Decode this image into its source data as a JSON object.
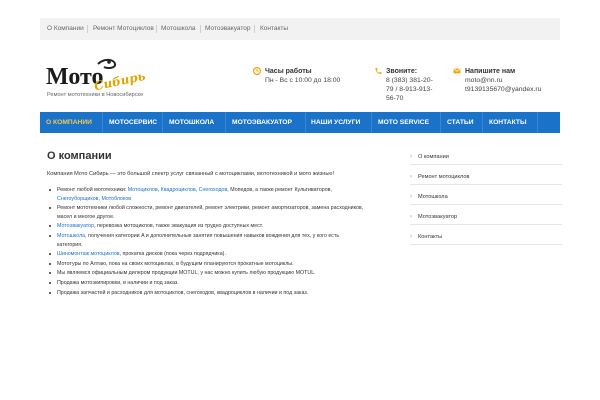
{
  "topbar": {
    "links": [
      "О Компании",
      "Ремонт Мотоциклов",
      "Мотошкола",
      "Мотоэвакуатор",
      "Контакты"
    ]
  },
  "header": {
    "logo_text": "Мото Сибирь",
    "tagline": "Ремонт мототехники в Новосибирске",
    "hours": {
      "title": "Часы работы",
      "value": "Пн - Вс с 10:00 до 18:00"
    },
    "phone": {
      "title": "Звоните:",
      "lines": [
        "8 (383) 381-20-",
        "79 / 8-913-913-",
        "56-70"
      ]
    },
    "email": {
      "title": "Напишите нам",
      "lines": [
        "moto@nn.ru",
        "t9139135670@yandex.ru"
      ]
    }
  },
  "nav": {
    "items": [
      "О КОМПАНИИ",
      "МОТОСЕРВИС",
      "МОТОШКОЛА",
      "МОТОЭВАКУАТОР",
      "НАШИ УСЛУГИ",
      "MOTO SERVICE",
      "СТАТЬИ",
      "КОНТАКТЫ"
    ],
    "active_index": 0
  },
  "main": {
    "title": "О компании",
    "intro": "Компания Мото Сибирь — это большой спектр услуг связанный с мотоциклами, мототехникой и мото жизнью!",
    "bullets": [
      {
        "lines": [
          [
            {
              "t": "Ремонт любой мототехники: "
            },
            {
              "t": "Мотоциклов",
              "link": true
            },
            {
              "t": ", "
            },
            {
              "t": "Квадроциклов",
              "link": true
            },
            {
              "t": ", "
            },
            {
              "t": "Снегоходов",
              "link": true
            },
            {
              "t": ", Мопедов, а также ремонт Культиваторов,"
            }
          ],
          [
            {
              "t": "Снегоуборщиков",
              "link": true
            },
            {
              "t": ", "
            },
            {
              "t": "Мотоблоков",
              "link": true
            }
          ]
        ]
      },
      {
        "lines": [
          [
            {
              "t": "Ремонт мототехники любой сложности, ремонт двигателей, ремонт электрики, ремонт амортизаторов, замена расходников,"
            }
          ],
          [
            {
              "t": "масел и многое другое."
            }
          ]
        ]
      },
      {
        "lines": [
          [
            {
              "t": "Мотоэвакуатор",
              "link": true
            },
            {
              "t": ", перевозка мотоциклов, также эвакуация из трудно доступных мест."
            }
          ]
        ]
      },
      {
        "lines": [
          [
            {
              "t": "Мотошкола",
              "link": true
            },
            {
              "t": ", получения категории A и дополнительные занятия повышения навыков вождения для тех, у кого есть"
            }
          ],
          [
            {
              "t": "категория."
            }
          ]
        ]
      },
      {
        "lines": [
          [
            {
              "t": "Шиномонтаж мотоциклов",
              "link": true
            },
            {
              "t": ", прокатка дисков (пока через подрядчика)."
            }
          ]
        ]
      },
      {
        "lines": [
          [
            {
              "t": "Мототуры по Алтаю, пока на своих мотоциклах, в будущем планируются прокатные мотоциклы."
            }
          ]
        ]
      },
      {
        "lines": [
          [
            {
              "t": "Мы являемся официальным дилером продукции MOTUL, у нас можно купить любую продукцию MOTUL."
            }
          ]
        ]
      },
      {
        "lines": [
          [
            {
              "t": "Продажа мотоэкипировки, в наличии и под заказ."
            }
          ]
        ]
      },
      {
        "lines": [
          [
            {
              "t": "Продажа запчастей и расходников для мотоциклов, снегоходов, квадроциклов в наличии и под заказ."
            }
          ]
        ]
      }
    ]
  },
  "sidebar": {
    "items": [
      "О компании",
      "Ремонт мотоциклов",
      "Мотошкола",
      "Мотоэвакуатор",
      "Контакты"
    ]
  },
  "colors": {
    "nav_bg": "#1a72c9",
    "nav_active": "#f2c94c",
    "link": "#1a72c9",
    "icon": "#f0a500"
  }
}
